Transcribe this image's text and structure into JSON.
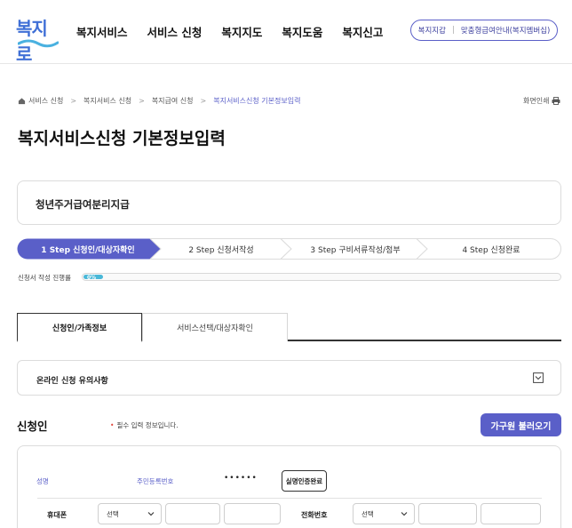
{
  "header": {
    "logo_text": "복지로",
    "nav": [
      "복지서비스",
      "서비스 신청",
      "복지지도",
      "복지도움",
      "복지신고"
    ],
    "top_button": {
      "left": "복지지갑",
      "separator": "|",
      "right": "맞춤형급여안내(복지멤버십)"
    }
  },
  "breadcrumb": {
    "items": [
      "서비스 신청",
      "복지서비스 신청",
      "복지급여 신청",
      "복지서비스신청 기본정보입력"
    ],
    "separator": ">",
    "print_label": "화면인쇄"
  },
  "page_title": "복지서비스신청 기본정보입력",
  "service_name": "청년주거급여분리지급",
  "steps": [
    {
      "label": "1 Step 신청인/대상자확인",
      "active": true
    },
    {
      "label": "2 Step 신청서작성",
      "active": false
    },
    {
      "label": "3 Step 구비서류작성/첨부",
      "active": false
    },
    {
      "label": "4 Step 신청완료",
      "active": false
    }
  ],
  "progress": {
    "label": "신청서 작성 진행률",
    "percent_text": "0%",
    "value": 0
  },
  "tabs": [
    {
      "label": "신청인/가족정보",
      "active": true
    },
    {
      "label": "서비스선택/대상자확인",
      "active": false
    }
  ],
  "notice": {
    "label": "온라인 신청 유의사항"
  },
  "applicant": {
    "title": "신청인",
    "required_note": "필수 입력 정보입니다.",
    "required_mark": "•",
    "family_button": "가구원 불러오기",
    "name_label": "성명",
    "rrn_label": "주민등록번호",
    "rrn_value": "••••••",
    "verify_button": "실명인증완료",
    "mobile_label": "휴대폰",
    "mobile_select": "선택",
    "phone_label": "전화번호",
    "phone_select": "선택"
  },
  "colors": {
    "accent": "#5a5fc8",
    "progress": "#49b8d8",
    "required": "#e0463c"
  }
}
